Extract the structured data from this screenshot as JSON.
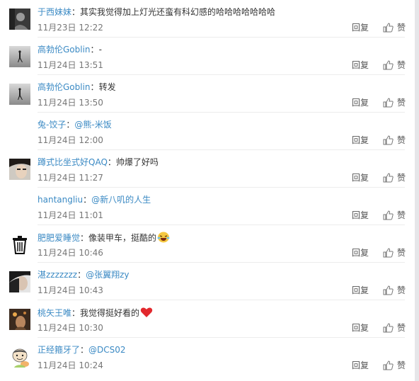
{
  "comments": [
    {
      "user": "于西妹妹",
      "sep": "：",
      "text": "其实我觉得加上灯光还蛮有科幻感的哈哈哈哈哈哈哈",
      "mention": "",
      "emoji": "",
      "time": "11月23日 12:22",
      "reply": "回复",
      "like": "赞"
    },
    {
      "user": "高勃伦Goblin",
      "sep": "：",
      "text": "-",
      "mention": "",
      "emoji": "",
      "time": "11月24日 13:51",
      "reply": "回复",
      "like": "赞"
    },
    {
      "user": "高勃伦Goblin",
      "sep": "：",
      "text": "转发",
      "mention": "",
      "emoji": "",
      "time": "11月24日 13:50",
      "reply": "回复",
      "like": "赞"
    },
    {
      "user": "兔-饺子",
      "sep": "：",
      "text": "",
      "mention": "@熊-米饭",
      "emoji": "",
      "time": "11月24日 12:00",
      "reply": "回复",
      "like": "赞"
    },
    {
      "user": "蹲式比坐式好QAQ",
      "sep": "：",
      "text": "帅爆了好吗",
      "mention": "",
      "emoji": "",
      "time": "11月24日 11:27",
      "reply": "回复",
      "like": "赞"
    },
    {
      "user": "hantangliu",
      "sep": "：",
      "text": "",
      "mention": "@新八叽的人生",
      "emoji": "",
      "time": "11月24日 11:01",
      "reply": "回复",
      "like": "赞"
    },
    {
      "user": "肥肥爱睡觉",
      "sep": "：",
      "text": "像装甲车，挺酷的",
      "mention": "",
      "emoji": "laugh-cry-emoji",
      "time": "11月24日 10:46",
      "reply": "回复",
      "like": "赞"
    },
    {
      "user": "湛zzzzzzz",
      "sep": "：",
      "text": "",
      "mention": "@张翼翔zy",
      "emoji": "",
      "time": "11月24日 10:43",
      "reply": "回复",
      "like": "赞"
    },
    {
      "user": "桃矢王唯",
      "sep": "：",
      "text": "我觉得挺好看的",
      "mention": "",
      "emoji": "heart-emoji",
      "time": "11月24日 10:30",
      "reply": "回复",
      "like": "赞"
    },
    {
      "user": "正经箍牙了",
      "sep": "：",
      "text": "",
      "mention": "@DCS02",
      "emoji": "",
      "time": "11月24日 10:24",
      "reply": "回复",
      "like": "赞"
    }
  ],
  "icons": {
    "like": "thumbs-up-icon"
  },
  "colors": {
    "username": "#3b8ac4",
    "text": "#333333",
    "time": "#777777",
    "background": "#f2f2f5"
  }
}
